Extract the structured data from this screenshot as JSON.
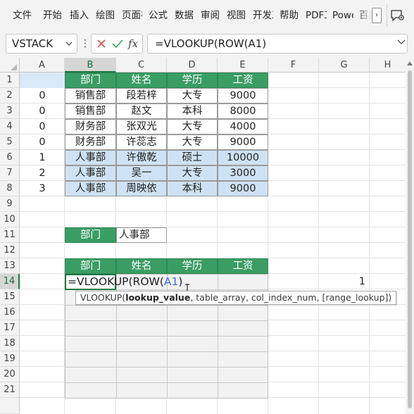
{
  "ribbon": {
    "tabs": [
      "文件",
      "开始",
      "插入",
      "绘图",
      "页面布局",
      "公式",
      "数据",
      "审阅",
      "视图",
      "开发工具",
      "帮助",
      "PDF工具集",
      "Power Pivot",
      "百度网盘"
    ],
    "more_label": "›"
  },
  "formula_bar": {
    "name_box": "VSTACK",
    "fx_label": "fx",
    "formula": "=VLOOKUP(ROW(A1)"
  },
  "columns": [
    "A",
    "B",
    "C",
    "D",
    "E",
    "F",
    "G",
    "H"
  ],
  "selected_column": "B",
  "rows": [
    "1",
    "2",
    "3",
    "4",
    "5",
    "6",
    "7",
    "8",
    "9",
    "10",
    "11",
    "12",
    "13",
    "14",
    "15",
    "16",
    "17",
    "18",
    "19",
    "20",
    "21"
  ],
  "selected_row": "14",
  "table": {
    "headers": [
      "部门",
      "姓名",
      "学历",
      "工资"
    ],
    "rows": [
      [
        "销售部",
        "段若梓",
        "大专",
        "9000"
      ],
      [
        "销售部",
        "赵文",
        "本科",
        "8000"
      ],
      [
        "财务部",
        "张双光",
        "大专",
        "4000"
      ],
      [
        "财务部",
        "许蕊志",
        "大专",
        "9000"
      ],
      [
        "人事部",
        "许傲乾",
        "硕士",
        "10000"
      ],
      [
        "人事部",
        "吴一",
        "大专",
        "3000"
      ],
      [
        "人事部",
        "周映依",
        "本科",
        "9000"
      ]
    ],
    "highlighted_rows": [
      4,
      5,
      6
    ]
  },
  "helper_column_a": [
    "",
    "0",
    "0",
    "0",
    "0",
    "1",
    "2",
    "3"
  ],
  "criteria": {
    "label": "部门",
    "value": "人事部"
  },
  "result_table": {
    "headers": [
      "部门",
      "姓名",
      "学历",
      "工资"
    ]
  },
  "editing_cell": {
    "prefix": "=VLOOKUP(ROW(",
    "ref": "A1",
    "suffix": ")"
  },
  "g14_value": "1",
  "tooltip": {
    "function": "VLOOKUP(",
    "current_arg": "lookup_value",
    "rest": ", table_array, col_index_num, [range_lookup])"
  },
  "colors": {
    "header_green": "#3a9d64",
    "highlight_blue": "#cfe2f3",
    "active_border": "#217346",
    "ref_blue": "#3b6fd6"
  }
}
